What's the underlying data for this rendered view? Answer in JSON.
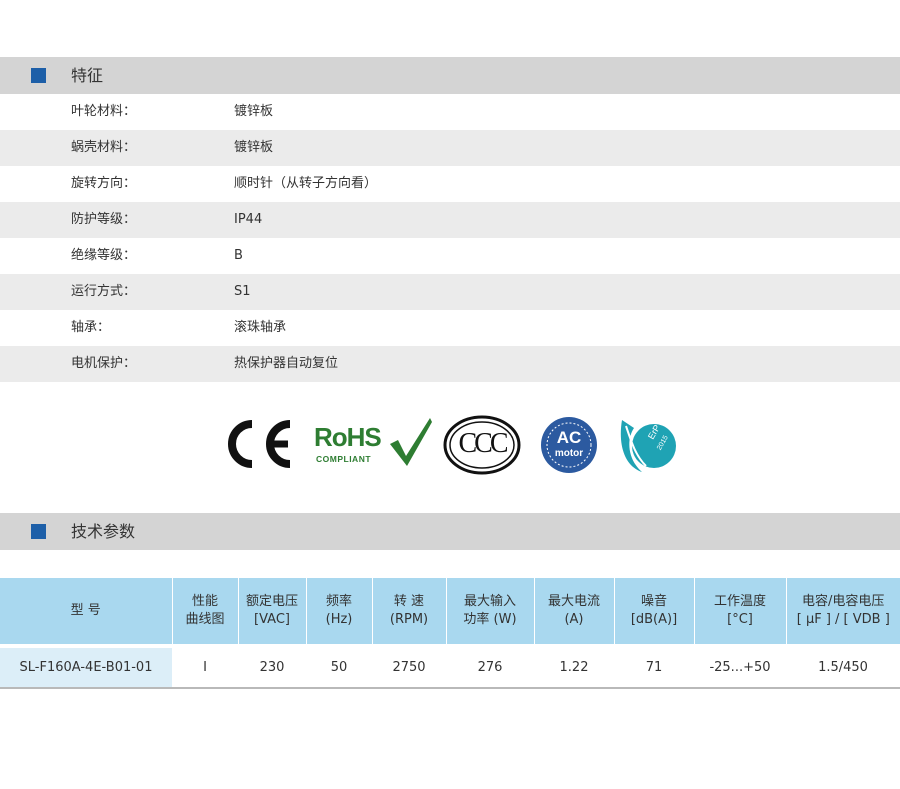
{
  "features": {
    "title": "特征",
    "rows": [
      {
        "label": "叶轮材料：",
        "value": "镀锌板"
      },
      {
        "label": "蜗壳材料：",
        "value": "镀锌板"
      },
      {
        "label": "旋转方向：",
        "value": "顺时针（从转子方向看）"
      },
      {
        "label": "防护等级：",
        "value": "IP44"
      },
      {
        "label": "绝缘等级：",
        "value": "B"
      },
      {
        "label": "运行方式：",
        "value": "S1"
      },
      {
        "label": "轴承：",
        "value": "滚珠轴承"
      },
      {
        "label": "电机保护：",
        "value": "热保护器自动复位"
      }
    ]
  },
  "certifications": {
    "ce": "CE",
    "rohs": "RoHS",
    "rohs_sub": "COMPLIANT",
    "ccc": "CCC",
    "ac_motor_top": "AC",
    "ac_motor_bottom": "motor",
    "erp_top": "ErP",
    "erp_bottom": "2015"
  },
  "tech": {
    "title": "技术参数",
    "headers": [
      {
        "line1": "型 号",
        "line2": ""
      },
      {
        "line1": "性能",
        "line2": "曲线图"
      },
      {
        "line1": "额定电压",
        "line2": "[VAC]"
      },
      {
        "line1": "频率",
        "line2": "(Hz)"
      },
      {
        "line1": "转 速",
        "line2": "(RPM)"
      },
      {
        "line1": "最大输入",
        "line2": "功率 (W)"
      },
      {
        "line1": "最大电流",
        "line2": "(A)"
      },
      {
        "line1": "噪音",
        "line2": "[dB(A)]"
      },
      {
        "line1": "工作温度",
        "line2": "[°C]"
      },
      {
        "line1": "电容/电容电压",
        "line2": "[ μF ] / [ VDB ]"
      }
    ],
    "rows": [
      [
        "SL-F160A-4E-B01-01",
        "I",
        "230",
        "50",
        "2750",
        "276",
        "1.22",
        "71",
        "-25...+50",
        "1.5/450"
      ]
    ]
  },
  "colors": {
    "accent": "#1d5fa8",
    "header_bg": "#d4d4d4",
    "table_header": "#a9d8ef",
    "rohs_green": "#2e7d32",
    "ac_blue": "#2c5aa0",
    "erp_teal": "#1fa3b4"
  }
}
